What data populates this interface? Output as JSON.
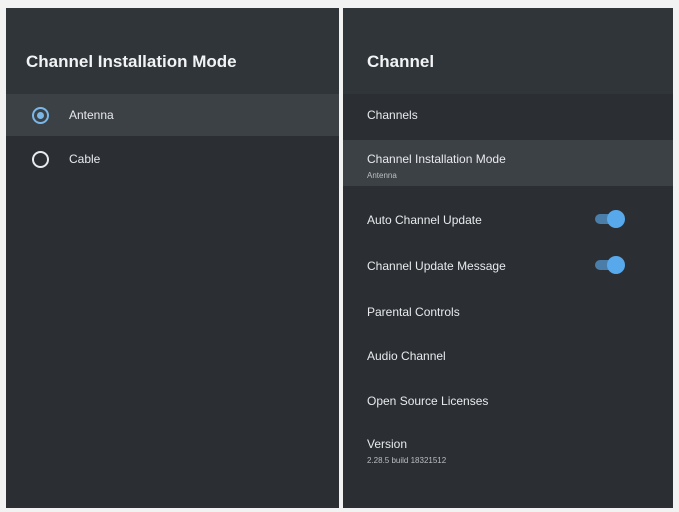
{
  "left_panel": {
    "title": "Channel Installation Mode",
    "options": [
      {
        "label": "Antenna",
        "selected": true
      },
      {
        "label": "Cable",
        "selected": false
      }
    ]
  },
  "right_panel": {
    "title": "Channel",
    "items": [
      {
        "label": "Channels"
      },
      {
        "label": "Channel Installation Mode",
        "sublabel": "Antenna"
      },
      {
        "label": "Auto Channel Update",
        "toggle": true
      },
      {
        "label": "Channel Update Message",
        "toggle": true
      },
      {
        "label": "Parental Controls"
      },
      {
        "label": "Audio Channel"
      },
      {
        "label": "Open Source Licenses"
      },
      {
        "label": "Version",
        "sublabel": "2.28.5 build 18321512"
      }
    ]
  },
  "colors": {
    "panel_bg": "#2b2f33",
    "header_bg": "#30353a",
    "focus_bg": "#3c4146",
    "accent": "#58a9ec"
  }
}
